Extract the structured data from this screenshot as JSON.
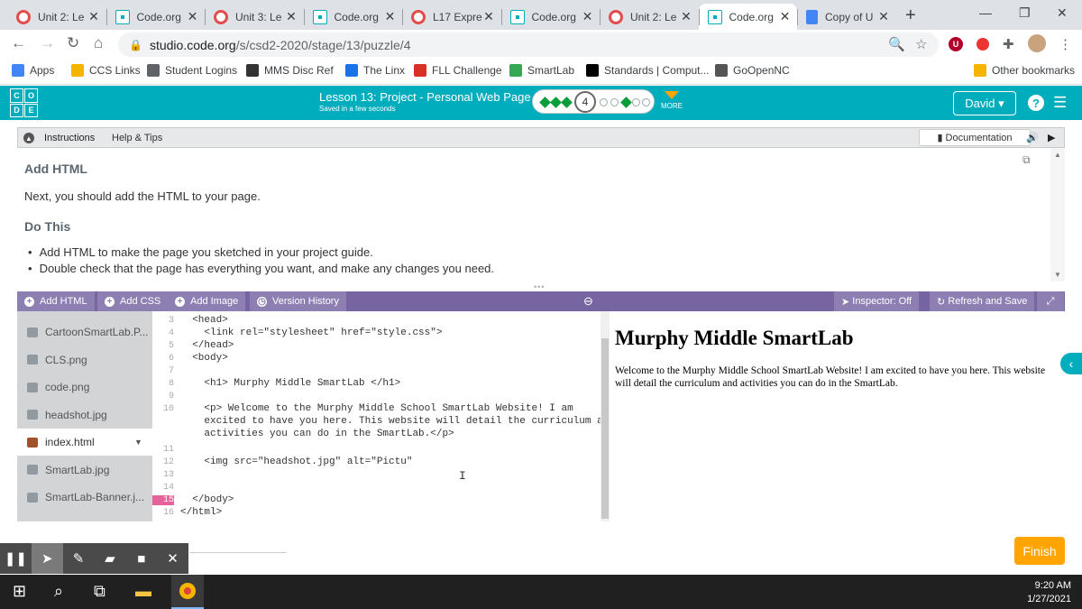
{
  "browser": {
    "tabs": [
      {
        "title": "Unit 2: Le",
        "favicon": "redcircle"
      },
      {
        "title": "Code.org",
        "favicon": "codeorg"
      },
      {
        "title": "Unit 3: Le",
        "favicon": "redcircle"
      },
      {
        "title": "Code.org",
        "favicon": "codeorg"
      },
      {
        "title": "L17 Expre",
        "favicon": "redcircle"
      },
      {
        "title": "Code.org",
        "favicon": "codeorg"
      },
      {
        "title": "Unit 2: Le",
        "favicon": "redcircle"
      },
      {
        "title": "Code.org",
        "favicon": "codeorg",
        "active": true
      },
      {
        "title": "Copy of U",
        "favicon": "gdoc"
      }
    ],
    "url_host": "studio.code.org",
    "url_path": "/s/csd2-2020/stage/13/puzzle/4",
    "bookmarks": [
      {
        "label": "Apps",
        "color": "#4285f4"
      },
      {
        "label": "CCS Links",
        "color": "#f4b400"
      },
      {
        "label": "Student Logins",
        "color": "#5f6368"
      },
      {
        "label": "MMS Disc Ref",
        "color": "#333333"
      },
      {
        "label": "The Linx",
        "color": "#1a73e8"
      },
      {
        "label": "FLL Challenge",
        "color": "#d93025"
      },
      {
        "label": "SmartLab",
        "color": "#34a853"
      },
      {
        "label": "Standards | Comput...",
        "color": "#000000"
      },
      {
        "label": "GoOpenNC",
        "color": "#555555"
      }
    ],
    "other_bookmarks": "Other bookmarks"
  },
  "header": {
    "logo_letters": [
      "C",
      "O",
      "D",
      "E"
    ],
    "lesson_title": "Lesson 13: Project - Personal Web Page",
    "saved_status": "Saved in a few seconds",
    "current_level": "4",
    "more_label": "MORE",
    "user_name": "David"
  },
  "instructions": {
    "tab_instructions": "Instructions",
    "tab_help": "Help & Tips",
    "documentation_label": "Documentation",
    "heading1": "Add HTML",
    "para1": "Next, you should add the HTML to your page.",
    "heading2": "Do This",
    "bullets": [
      "Add HTML to make the page you sketched in your project guide.",
      "Double check that the page has everything you want, and make any changes you need."
    ]
  },
  "toolbar": {
    "add_html": "Add HTML",
    "add_css": "Add CSS",
    "add_image": "Add Image",
    "version_history": "Version History",
    "inspector": "Inspector: Off",
    "refresh_save": "Refresh and Save"
  },
  "files": [
    {
      "name": "CartoonSmartLab.P..."
    },
    {
      "name": "CLS.png"
    },
    {
      "name": "code.png"
    },
    {
      "name": "headshot.jpg"
    },
    {
      "name": "index.html",
      "selected": true
    },
    {
      "name": "SmartLab.jpg"
    },
    {
      "name": "SmartLab-Banner.j..."
    }
  ],
  "code_lines": [
    {
      "n": "3",
      "text": "  <head>"
    },
    {
      "n": "4",
      "text": "    <link rel=\"stylesheet\" href=\"style.css\">"
    },
    {
      "n": "5",
      "text": "  </head>"
    },
    {
      "n": "6",
      "text": "  <body>"
    },
    {
      "n": "7",
      "text": ""
    },
    {
      "n": "8",
      "text": "    <h1> Murphy Middle SmartLab </h1>"
    },
    {
      "n": "9",
      "text": ""
    },
    {
      "n": "10",
      "text": "    <p> Welcome to the Murphy Middle School SmartLab Website! I am"
    },
    {
      "n": "",
      "text": "    excited to have you here. This website will detail the curriculum and"
    },
    {
      "n": "",
      "text": "    activities you can do in the SmartLab.</p>"
    },
    {
      "n": "11",
      "text": ""
    },
    {
      "n": "12",
      "text": "    <img src=\"headshot.jpg\" alt=\"Pictu\""
    },
    {
      "n": "13",
      "text": ""
    },
    {
      "n": "14",
      "text": ""
    },
    {
      "n": "15",
      "text": "  </body>",
      "error": true
    },
    {
      "n": "16",
      "text": "</html>"
    }
  ],
  "preview": {
    "heading": "Murphy Middle SmartLab",
    "paragraph": "Welcome to the Murphy Middle School SmartLab Website! I am excited to have you here. This website will detail the curriculum and activities you can do in the SmartLab."
  },
  "finish_label": "Finish",
  "clock": {
    "time": "9:20 AM",
    "date": "1/27/2021"
  }
}
